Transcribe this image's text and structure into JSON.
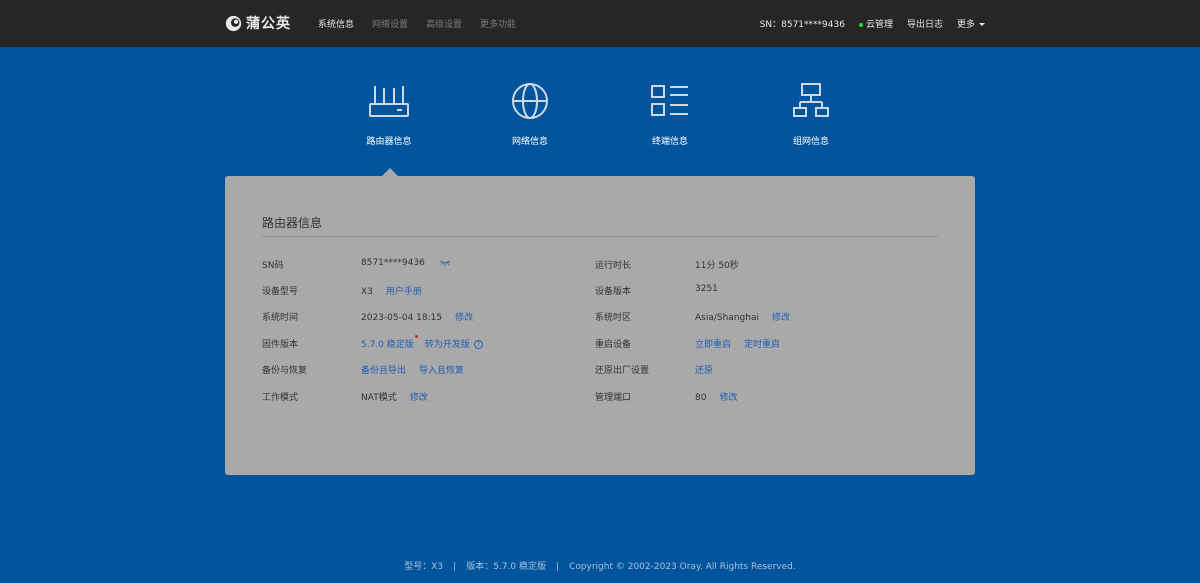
{
  "brand": {
    "name": "蒲公英"
  },
  "nav": [
    {
      "label": "系统信息"
    },
    {
      "label": "网络设置"
    },
    {
      "label": "高级设置"
    },
    {
      "label": "更多功能"
    }
  ],
  "header_right": {
    "sn": "SN：8571****9436",
    "cloud": "云管理",
    "export_log": "导出日志",
    "more": "更多"
  },
  "icon_tabs": [
    {
      "label": "路由器信息",
      "icon": "router-icon"
    },
    {
      "label": "网络信息",
      "icon": "globe-icon"
    },
    {
      "label": "终端信息",
      "icon": "list-icon"
    },
    {
      "label": "组网信息",
      "icon": "network-topology-icon"
    }
  ],
  "panel": {
    "title": "路由器信息",
    "left": [
      {
        "label": "SN码",
        "value": "8571****9436"
      },
      {
        "label": "设备型号",
        "value": "X3",
        "link": "用户手册"
      },
      {
        "label": "系统时间",
        "value": "2023-05-04 18:15",
        "link": "修改"
      },
      {
        "label": "固件版本",
        "link": "5.7.0 稳定版",
        "link2": "转为开发版"
      },
      {
        "label": "备份与恢复",
        "link": "备份且导出",
        "link2": "导入且恢复"
      },
      {
        "label": "工作模式",
        "value": "NAT模式",
        "link": "修改"
      }
    ],
    "right": [
      {
        "label": "运行时长",
        "value": "11分 50秒"
      },
      {
        "label": "设备版本",
        "value": "3251"
      },
      {
        "label": "系统时区",
        "value": "Asia/Shanghai",
        "link": "修改"
      },
      {
        "label": "重启设备",
        "link": "立即重启",
        "link2": "定时重启"
      },
      {
        "label": "还原出厂设置",
        "link": "还原"
      },
      {
        "label": "管理端口",
        "value": "80",
        "link": "修改"
      }
    ]
  },
  "footer": {
    "model": "型号：X3",
    "version": "版本：5.7.0 稳定版",
    "copyright": "Copyright © 2002-2023 Oray. All Rights Reserved."
  },
  "colors": {
    "background": "#02549c",
    "topbar": "#262626",
    "panel": "#a9a9a9",
    "link": "#1f5fb5"
  }
}
